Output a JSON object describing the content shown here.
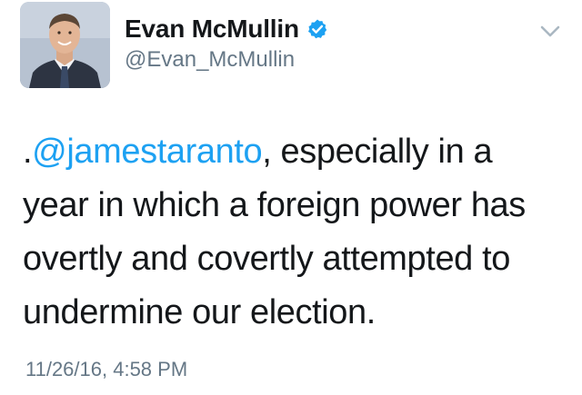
{
  "author": {
    "display_name": "Evan McMullin",
    "handle": "@Evan_McMullin",
    "verified": true
  },
  "tweet": {
    "prefix": ".",
    "mention": "@jamestaranto",
    "line1_rest": ", especially in a",
    "line2": "year in which a foreign power has",
    "line3": "overtly and covertly attempted to",
    "line4": "undermine our election."
  },
  "timestamp": "11/26/16, 4:58 PM",
  "colors": {
    "mention": "#1da1f2",
    "verified_badge": "#1da1f2",
    "secondary_text": "#657786",
    "primary_text": "#14171a"
  },
  "icons": {
    "verified": "verified-badge-icon",
    "menu": "chevron-down-icon"
  }
}
